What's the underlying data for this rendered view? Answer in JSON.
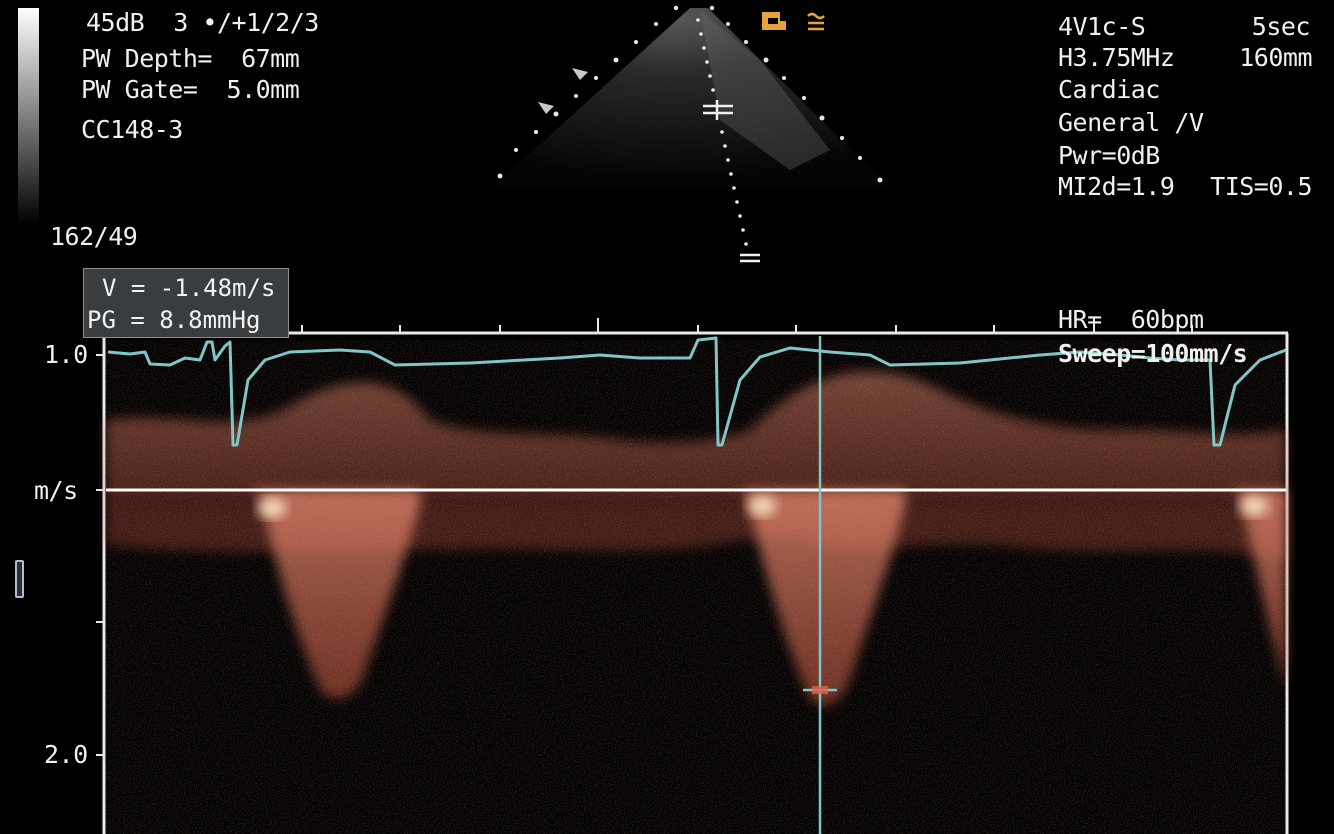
{
  "left_info": {
    "line1": "45dB  3 •/+1/2/3",
    "line2": "PW Depth=  67mm",
    "line3": "PW Gate=  5.0mm",
    "line4": "CC148-3",
    "scale": "162/49"
  },
  "right_info": {
    "probe": "4V1c-S",
    "sweep_time": "5sec",
    "freq": "H3.75MHz",
    "depth": "160mm",
    "preset": "Cardiac",
    "mode": "General /V",
    "power": "Pwr=0dB",
    "mi": "MI2d=1.9",
    "tis": "TIS=0.5"
  },
  "measurement": {
    "velocity": "V = -1.48m/s",
    "gradient": "PG = 8.8mmHg"
  },
  "spectral": {
    "hr": "HR=  60bpm",
    "sweep": "Sweep=100mm/s",
    "axis_top": "1.0",
    "axis_unit": "m/s",
    "axis_bottom": "2.0"
  },
  "icons": {
    "orientation": "orientation-marker-icon",
    "compound": "approx-icon"
  },
  "colors": {
    "doppler": "#d66a52",
    "ecg": "#7fc6c8",
    "orientation": "#e6a23c",
    "box": "#3a3d40"
  }
}
